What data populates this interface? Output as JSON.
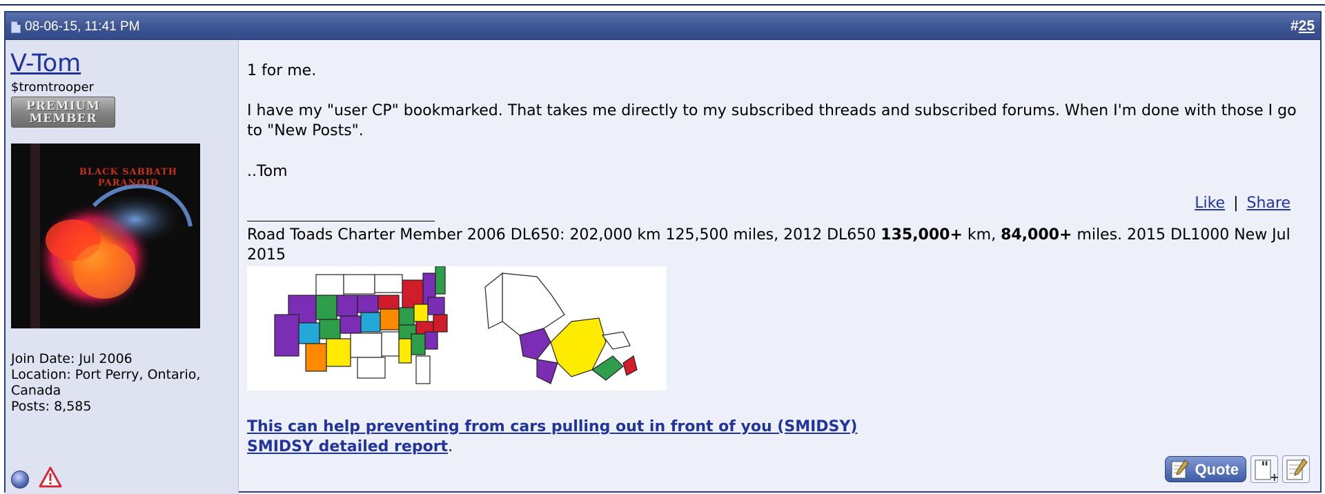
{
  "post": {
    "date": "08-06-15, 11:41 PM",
    "number_prefix": "#",
    "number": "25"
  },
  "user": {
    "name": "V-Tom",
    "title": "$tromtrooper",
    "badge_line1": "PREMIUM",
    "badge_line2": "MEMBER",
    "avatar_text_line1": "BLACK SABBATH",
    "avatar_text_line2": "PARANOID",
    "join_date": "Join Date: Jul 2006",
    "location": "Location: Port Perry, Ontario,",
    "location_cont": "Canada",
    "posts": "Posts: 8,585"
  },
  "message": {
    "line1": "1 for me.",
    "line2": "I have my \"user CP\" bookmarked. That takes me directly to my subscribed threads and subscribed forums. When I'm done with those I go to \"New Posts\".",
    "line3": "..Tom"
  },
  "actions": {
    "like": "Like",
    "separator": "|",
    "share": "Share"
  },
  "signature": {
    "part1": "Road Toads Charter Member 2006 DL650: 202,000 km 125,500 miles, 2012 DL650 ",
    "bold1": "135,000+",
    "part2": " km, ",
    "bold2": "84,000+",
    "part3": " miles. 2015 DL1000 New Jul 2015",
    "link1": "This can help preventing from cars pulling out in front of you (SMIDSY)",
    "link2": "SMIDSY detailed report",
    "link2_tail": "."
  },
  "buttons": {
    "quote": "Quote"
  },
  "colors": {
    "header": "#3c5592",
    "link": "#21349c",
    "user_col": "#dfe3f1",
    "body": "#eef0f9"
  }
}
